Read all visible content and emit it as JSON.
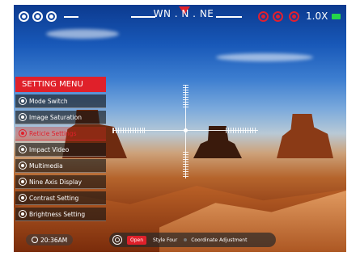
{
  "top_bar": {
    "left_icons": [
      "wifi-icon",
      "no-entry-icon",
      "target-icon"
    ],
    "compass_heading": "WN . N . NE",
    "right_icons": [
      "record-icon",
      "video-icon",
      "camera-icon"
    ],
    "zoom": "1.0X",
    "battery_color": "#25d64a"
  },
  "menu": {
    "title": "SETTING MENU",
    "items": [
      {
        "label": "Mode Switch",
        "icon": "mode-icon",
        "active": false
      },
      {
        "label": "Image Saturation",
        "icon": "saturation-icon",
        "active": false
      },
      {
        "label": "Reticle Settings",
        "icon": "reticle-icon",
        "active": true
      },
      {
        "label": "Impact Video",
        "icon": "eye-icon",
        "active": false
      },
      {
        "label": "Multimedia",
        "icon": "multimedia-icon",
        "active": false
      },
      {
        "label": "Nine Axis Display",
        "icon": "axis-icon",
        "active": false
      },
      {
        "label": "Contrast Setting",
        "icon": "contrast-icon",
        "active": false
      },
      {
        "label": "Brightness Setting",
        "icon": "brightness-icon",
        "active": false
      }
    ]
  },
  "status": {
    "time": "20:36AM"
  },
  "reticle_bar": {
    "state": "Open",
    "style": "Style Four",
    "adjust_label": "Coordinate Adjustment"
  },
  "colors": {
    "accent": "#e0202a"
  }
}
